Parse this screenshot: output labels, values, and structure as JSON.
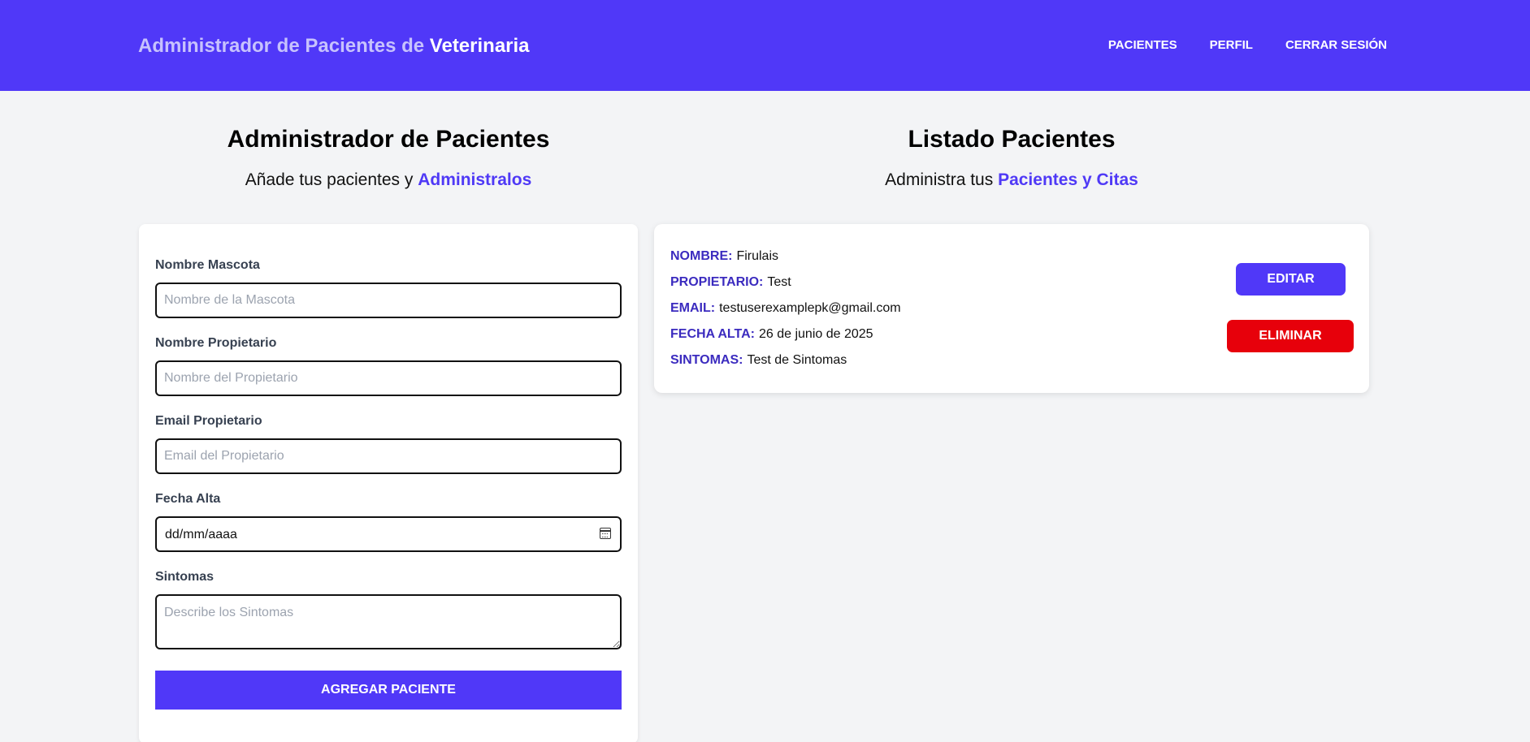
{
  "header": {
    "brand_prefix": "Administrador de Pacientes de",
    "brand_strong": "Veterinaria",
    "nav": [
      "PACIENTES",
      "PERFIL",
      "CERRAR SESIÓN"
    ]
  },
  "form_section": {
    "title": "Administrador de Pacientes",
    "subtitle_prefix": "Añade tus pacientes y",
    "subtitle_highlight": "Administralos"
  },
  "list_section": {
    "title": "Listado Pacientes",
    "subtitle_prefix": "Administra tus",
    "subtitle_highlight": "Pacientes y Citas"
  },
  "form": {
    "fields": [
      {
        "label": "Nombre Mascota",
        "placeholder": "Nombre de la Mascota",
        "value": ""
      },
      {
        "label": "Nombre Propietario",
        "placeholder": "Nombre del Propietario",
        "value": ""
      },
      {
        "label": "Email Propietario",
        "placeholder": "Email del Propietario",
        "value": ""
      },
      {
        "label": "Fecha Alta",
        "placeholder": "dd/mm/aaaa",
        "value": ""
      },
      {
        "label": "Sintomas",
        "placeholder": "Describe los Sintomas",
        "value": ""
      }
    ],
    "submit_label": "AGREGAR PACIENTE"
  },
  "patients": [
    {
      "rows": [
        {
          "key": "NOMBRE:",
          "value": "Firulais"
        },
        {
          "key": "PROPIETARIO:",
          "value": "Test"
        },
        {
          "key": "EMAIL:",
          "value": "testuserexamplepk@gmail.com"
        },
        {
          "key": "FECHA ALTA:",
          "value": "26 de junio de 2025"
        },
        {
          "key": "SINTOMAS:",
          "value": "Test de Sintomas"
        }
      ],
      "edit_label": "EDITAR",
      "delete_label": "ELIMINAR"
    }
  ],
  "colors": {
    "primary": "#5038f8",
    "danger": "#e7000b",
    "background": "#f3f4f6",
    "label_accent": "#3b2bbf"
  }
}
